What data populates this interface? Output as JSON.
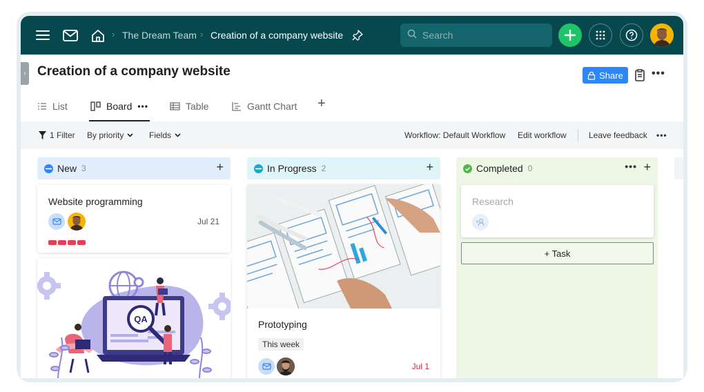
{
  "topbar": {
    "breadcrumb": [
      "The Dream Team",
      "Creation of a company website"
    ],
    "search_placeholder": "Search",
    "colors": {
      "background": "#07484e",
      "add_button": "#1fc46a"
    }
  },
  "page": {
    "title": "Creation of a company website",
    "share_label": "Share"
  },
  "views": {
    "tabs": [
      {
        "label": "List",
        "icon": "list-icon"
      },
      {
        "label": "Board",
        "icon": "board-icon",
        "active": true
      },
      {
        "label": "Table",
        "icon": "table-icon"
      },
      {
        "label": "Gantt Chart",
        "icon": "gantt-icon"
      }
    ]
  },
  "filterbar": {
    "filter_label": "1 Filter",
    "group_label": "By priority",
    "fields_label": "Fields",
    "workflow_label": "Workflow: Default Workflow",
    "edit_workflow_label": "Edit workflow",
    "feedback_label": "Leave feedback"
  },
  "columns": [
    {
      "name": "New",
      "count": "3",
      "color": "#e2eefb",
      "status_color": "#2f86f6",
      "cards": [
        {
          "title": "Website programming",
          "date": "Jul 21",
          "priority_bars": 4
        },
        {
          "image": "qa-illustration"
        }
      ]
    },
    {
      "name": "In Progress",
      "count": "2",
      "color": "#dff4f8",
      "status_color": "#17a9c9",
      "cards": [
        {
          "image": "wireframe-sketch-photo",
          "title": "Prototyping",
          "tag": "This week",
          "date": "Jul 1",
          "date_color": "#e0243a"
        }
      ]
    },
    {
      "name": "Completed",
      "count": "0",
      "color": "#eef7e5",
      "status_color": "#53b54f",
      "cards": [
        {
          "title": "Research"
        }
      ],
      "add_task_label": "+ Task"
    }
  ]
}
